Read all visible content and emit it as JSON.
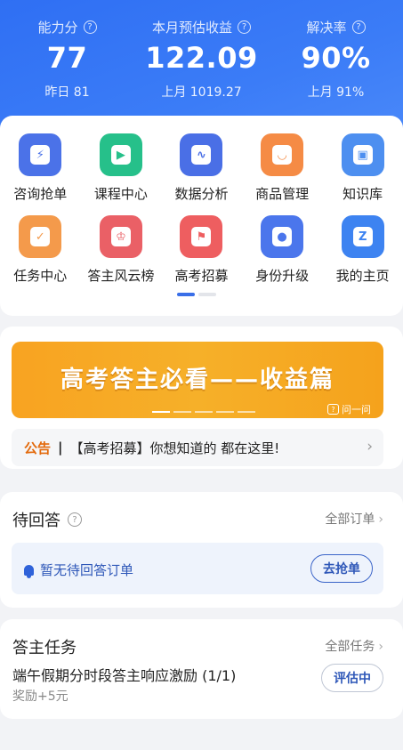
{
  "stats": [
    {
      "label": "能力分",
      "value": "77",
      "sub": "昨日 81"
    },
    {
      "label": "本月预估收益",
      "value": "122.09",
      "sub": "上月 1019.27"
    },
    {
      "label": "解决率",
      "value": "90%",
      "sub": "上月 91%"
    }
  ],
  "grid": [
    [
      {
        "label": "咨询抢单",
        "icon": "lightning-icon",
        "glyph": "⚡",
        "color": "#4b72e8"
      },
      {
        "label": "课程中心",
        "icon": "play-icon",
        "glyph": "▶",
        "color": "#26c08a"
      },
      {
        "label": "数据分析",
        "icon": "chart-icon",
        "glyph": "∿",
        "color": "#4a6fe6"
      },
      {
        "label": "商品管理",
        "icon": "bag-icon",
        "glyph": "◡",
        "color": "#f58b45"
      },
      {
        "label": "知识库",
        "icon": "book-icon",
        "glyph": "▣",
        "color": "#4d8ff0"
      }
    ],
    [
      {
        "label": "任务中心",
        "icon": "task-check-icon",
        "glyph": "✓",
        "color": "#f49a4b"
      },
      {
        "label": "答主风云榜",
        "icon": "trophy-icon",
        "glyph": "♔",
        "color": "#ea6066"
      },
      {
        "label": "高考招募",
        "icon": "flag-icon",
        "glyph": "⚑",
        "color": "#ee5e60"
      },
      {
        "label": "身份升级",
        "icon": "user-upgrade-icon",
        "glyph": "●",
        "color": "#4b76ec"
      },
      {
        "label": "我的主页",
        "icon": "home-z-icon",
        "glyph": "Z",
        "color": "#3d83f1"
      }
    ]
  ],
  "banner": {
    "title": "高考答主必看——收益篇",
    "badge": "问一问"
  },
  "notice": {
    "tag": "公告",
    "text": "【高考招募】你想知道的 都在这里!"
  },
  "pending": {
    "title": "待回答",
    "more": "全部订单",
    "empty": "暂无待回答订单",
    "button": "去抢单"
  },
  "tasks": {
    "title": "答主任务",
    "more": "全部任务",
    "name": "端午假期分时段答主响应激励 (1/1)",
    "reward": "奖励+5元",
    "button": "评估中"
  },
  "colors": {
    "header": "#3b7cf7",
    "accent": "#2e57b8",
    "notice_tag": "#e36a0c",
    "banner": "#f6b029"
  }
}
